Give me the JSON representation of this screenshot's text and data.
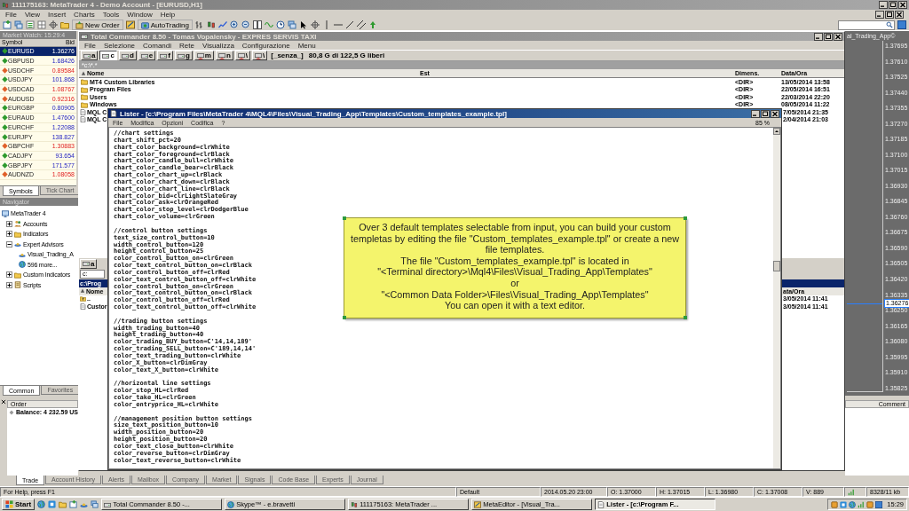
{
  "mt4": {
    "title": "111175163: MetaTrader 4 - Demo Account - [EURUSD,H1]",
    "menu": [
      "File",
      "View",
      "Insert",
      "Charts",
      "Tools",
      "Window",
      "Help"
    ],
    "new_order": "New Order",
    "autotrading": "AutoTrading"
  },
  "market_watch": {
    "title": "Market Watch: 15:29:4",
    "columns": [
      "Symbol",
      "Bid"
    ],
    "rows": [
      {
        "symbol": "EURUSD",
        "bid": "1.36276",
        "rising": true,
        "selected": true
      },
      {
        "symbol": "GBPUSD",
        "bid": "1.68426",
        "rising": true,
        "selected": false
      },
      {
        "symbol": "USDCHF",
        "bid": "0.89584",
        "rising": false,
        "selected": false
      },
      {
        "symbol": "USDJPY",
        "bid": "101.868",
        "rising": true,
        "selected": false
      },
      {
        "symbol": "USDCAD",
        "bid": "1.08767",
        "rising": false,
        "selected": false
      },
      {
        "symbol": "AUDUSD",
        "bid": "0.92316",
        "rising": false,
        "selected": false
      },
      {
        "symbol": "EURGBP",
        "bid": "0.80905",
        "rising": true,
        "selected": false
      },
      {
        "symbol": "EURAUD",
        "bid": "1.47600",
        "rising": true,
        "selected": false
      },
      {
        "symbol": "EURCHF",
        "bid": "1.22088",
        "rising": true,
        "selected": false
      },
      {
        "symbol": "EURJPY",
        "bid": "138.827",
        "rising": true,
        "selected": false
      },
      {
        "symbol": "GBPCHF",
        "bid": "1.30883",
        "rising": false,
        "selected": false
      },
      {
        "symbol": "CADJPY",
        "bid": "93.654",
        "rising": true,
        "selected": false
      },
      {
        "symbol": "GBPJPY",
        "bid": "171.577",
        "rising": true,
        "selected": false
      },
      {
        "symbol": "AUDNZD",
        "bid": "1.08058",
        "rising": false,
        "selected": false
      }
    ],
    "tabs": [
      {
        "label": "Symbols",
        "selected": true
      },
      {
        "label": "Tick Chart",
        "selected": false
      }
    ]
  },
  "navigator": {
    "title": "Navigator",
    "tree": [
      {
        "label": "MetaTrader 4",
        "kind": "root",
        "children": [
          {
            "label": "Accounts",
            "kind": "accounts",
            "expanded": false
          },
          {
            "label": "Indicators",
            "kind": "indicators",
            "expanded": false
          },
          {
            "label": "Expert Advisors",
            "kind": "experts",
            "expanded": true,
            "children": [
              {
                "label": "Visual_Trading_A",
                "kind": "expert"
              },
              {
                "label": "596 more...",
                "kind": "more"
              }
            ]
          },
          {
            "label": "Custom Indicators",
            "kind": "custom",
            "expanded": false
          },
          {
            "label": "Scripts",
            "kind": "scripts",
            "expanded": false
          }
        ]
      }
    ],
    "tabs": [
      {
        "label": "Common",
        "selected": true
      },
      {
        "label": "Favorites",
        "selected": false
      }
    ]
  },
  "terminal": {
    "order_header": "Order",
    "balance": "Balance: 4 232.59 US",
    "comment_header": "Comment",
    "tabs": [
      {
        "label": "Trade",
        "selected": true
      },
      {
        "label": "Account History",
        "selected": false
      },
      {
        "label": "Alerts",
        "selected": false
      },
      {
        "label": "Mailbox",
        "selected": false
      },
      {
        "label": "Company",
        "selected": false
      },
      {
        "label": "Market",
        "selected": false
      },
      {
        "label": "Signals",
        "selected": false
      },
      {
        "label": "Code Base",
        "selected": false
      },
      {
        "label": "Experts",
        "selected": false
      },
      {
        "label": "Journal",
        "selected": false
      }
    ]
  },
  "chart": {
    "label": "al_Trading_App©",
    "prices": [
      "1.37695",
      "1.37610",
      "1.37525",
      "1.37440",
      "1.37355",
      "1.37270",
      "1.37185",
      "1.37100",
      "1.37015",
      "1.36930",
      "1.36845",
      "1.36760",
      "1.36675",
      "1.36590",
      "1.36505",
      "1.36420",
      "1.36335",
      "1.36250",
      "1.36165",
      "1.36080",
      "1.35995",
      "1.35910",
      "1.35825"
    ],
    "current_price": "1.36276"
  },
  "total_commander": {
    "title": "Total Commander 8.50 - Tomas Vopalensky - EXPRES SERVIS TAXI",
    "menu": [
      "File",
      "Selezione",
      "Comandi",
      "Rete",
      "Visualizza",
      "Configurazione",
      "Menu"
    ],
    "drives": [
      {
        "label": "a",
        "selected": false
      },
      {
        "label": "c",
        "selected": true
      },
      {
        "label": "d",
        "selected": false
      },
      {
        "label": "e",
        "selected": false
      },
      {
        "label": "f",
        "selected": false
      },
      {
        "label": "g",
        "selected": false
      },
      {
        "label": "m",
        "selected": false
      },
      {
        "label": "n",
        "selected": false
      },
      {
        "label": "\\",
        "selected": false
      },
      {
        "label": "\\",
        "selected": false
      }
    ],
    "volume": "[_senza_]",
    "free_space": "80,8 G di 122,5 G liberi",
    "path": "*c:\\*.*",
    "columns": [
      "Nome",
      "Est",
      "Dimens.",
      "Data/Ora"
    ],
    "rows": [
      {
        "name": "MT4 Custom Libraries",
        "size": "<DIR>",
        "date": "13/05/2014 13:58"
      },
      {
        "name": "Program Files",
        "size": "<DIR>",
        "date": "22/05/2014 16:51"
      },
      {
        "name": "Users",
        "size": "<DIR>",
        "date": "22/03/2014 22:20"
      },
      {
        "name": "Windows",
        "size": "<DIR>",
        "date": "08/05/2014 11:22"
      }
    ],
    "partial_rows": [
      {
        "name": "MQL C",
        "date": "7/05/2014 21:35"
      },
      {
        "name": "MQL C",
        "date": "2/04/2014 21:03"
      }
    ],
    "lower_pane": {
      "drive": "a",
      "combo": "c:",
      "path": "c:\\Prog",
      "name_header": "Nome",
      "date_header": "ata/Ora",
      "rows": [
        {
          "name": "..",
          "date": "3/05/2014 11:41"
        },
        {
          "name": "Custor",
          "date": "3/05/2014 11:41"
        }
      ]
    }
  },
  "lister": {
    "title": "Lister - [c:\\Program Files\\MetaTrader 4\\MQL4\\Files\\Visual_Trading_App\\Templates\\Custom_templates_example.tpl]",
    "menu": [
      "File",
      "Modifica",
      "Opzioni",
      "Codifica",
      "?"
    ],
    "zoom": "85 %",
    "sections": [
      [
        "//chart settings",
        "chart_shift_pct=20",
        "chart_color_background=clrWhite",
        "chart_color_foreground=clrBlack",
        "chart_color_candle_bull=clrWhite",
        "chart_color_candle_bear=clrBlack",
        "chart_color_chart_up=clrBlack",
        "chart_color_chart_down=clrBlack",
        "chart_color_chart_line=clrBlack",
        "chart_color_bid=clrLightSlateGray",
        "chart_color_ask=clrOrangeRed",
        "chart_color_stop_level=clrDodgerBlue",
        "chart_color_volume=clrGreen"
      ],
      [
        "//control button settings",
        "text_size_control_button=10",
        "width_control_button=120",
        "height_control_button=25",
        "color_control_button_on=clrGreen",
        "color_text_control_button_on=clrBlack",
        "color_control_button_off=clrRed",
        "color_text_control_button_off=clrWhite",
        "color_control_button_on=clrGreen",
        "color_text_control_button_on=clrBlack",
        "color_control_button_off=clrRed",
        "color_text_control_button_off=clrWhite"
      ],
      [
        "//trading button settings",
        "width_trading_button=40",
        "height_trading_button=40",
        "color_trading_BUY_button=C'14,14,189'",
        "color_trading_SELL_button=C'189,14,14'",
        "color_text_trading_button=clrWhite",
        "color_X_button=clrDimGray",
        "color_text_X_button=clrWhite"
      ],
      [
        "//horizontal line settings",
        "color_stop_HL=clrRed",
        "color_take_HL=clrGreen",
        "color_entryprice_HL=clrWhite"
      ],
      [
        "//management position button settings",
        "size_text_position_button=10",
        "width_position_button=20",
        "height_position_button=20",
        "color_text_close_button=clrWhite",
        "color_reverse_button=clrDimGray",
        "color_text_reverse_button=clrWhite"
      ]
    ]
  },
  "tooltip": {
    "paragraphs": [
      "Over 3 default templates selectable from input, you can build your custom templetas by editing the file \"Custom_templates_example.tpl\" or create a new file templates.",
      "The file \"Custom_templates_example.tpl\" is located in",
      "\"<Terminal directory>\\Mql4\\Files\\Visual_Trading_App\\Templates\"",
      "or",
      "\"<Common Data Folder>\\Files\\Visual_Trading_App\\Templates\"",
      "You can open it with a text editor."
    ]
  },
  "status_bar": [
    "For Help, press F1",
    "Default",
    "2014.05.20 23:00",
    "O: 1.37000",
    "H: 1.37015",
    "L: 1.36980",
    "C: 1.37008",
    "V: 889",
    "8328/11 kb"
  ],
  "taskbar": {
    "start": "Start",
    "tasks": [
      {
        "label": "Total Commander 8.50 -...",
        "selected": false
      },
      {
        "label": "Skype™ - e.bravetti",
        "selected": false
      },
      {
        "label": "111175163: MetaTrader ...",
        "selected": false
      },
      {
        "label": "MetaEditor - [Visual_Tra...",
        "selected": false
      },
      {
        "label": "Lister - [c:\\Program F...",
        "selected": true
      }
    ],
    "clock": "15:29"
  }
}
